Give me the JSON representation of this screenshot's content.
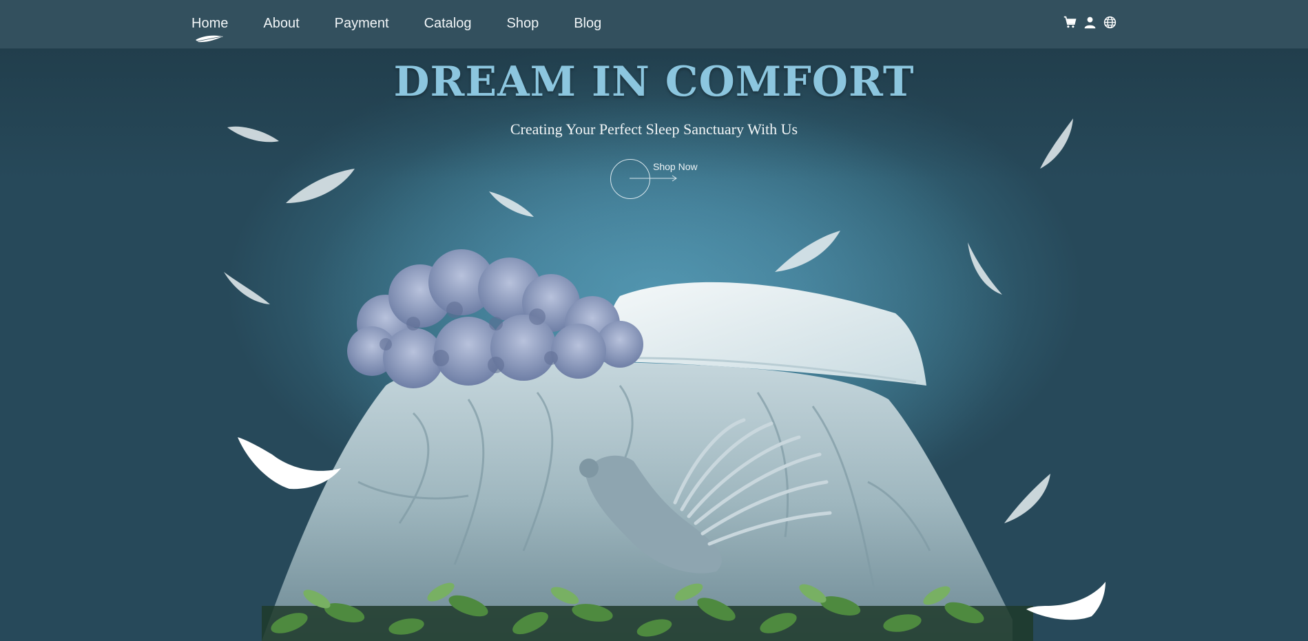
{
  "nav": {
    "links": [
      {
        "label": "Home",
        "active": true
      },
      {
        "label": "About"
      },
      {
        "label": "Payment"
      },
      {
        "label": "Catalog"
      },
      {
        "label": "Shop"
      },
      {
        "label": "Blog"
      }
    ],
    "icons": [
      "cart-icon",
      "user-icon",
      "globe-icon"
    ]
  },
  "hero": {
    "title": "DREAM IN COMFORT",
    "subtitle": "Creating Your Perfect Sleep Sanctuary With Us",
    "cta_label": "Shop Now"
  },
  "colors": {
    "nav_bg": "#33505e",
    "title": "#8cc6df",
    "background": "#3f7890"
  }
}
